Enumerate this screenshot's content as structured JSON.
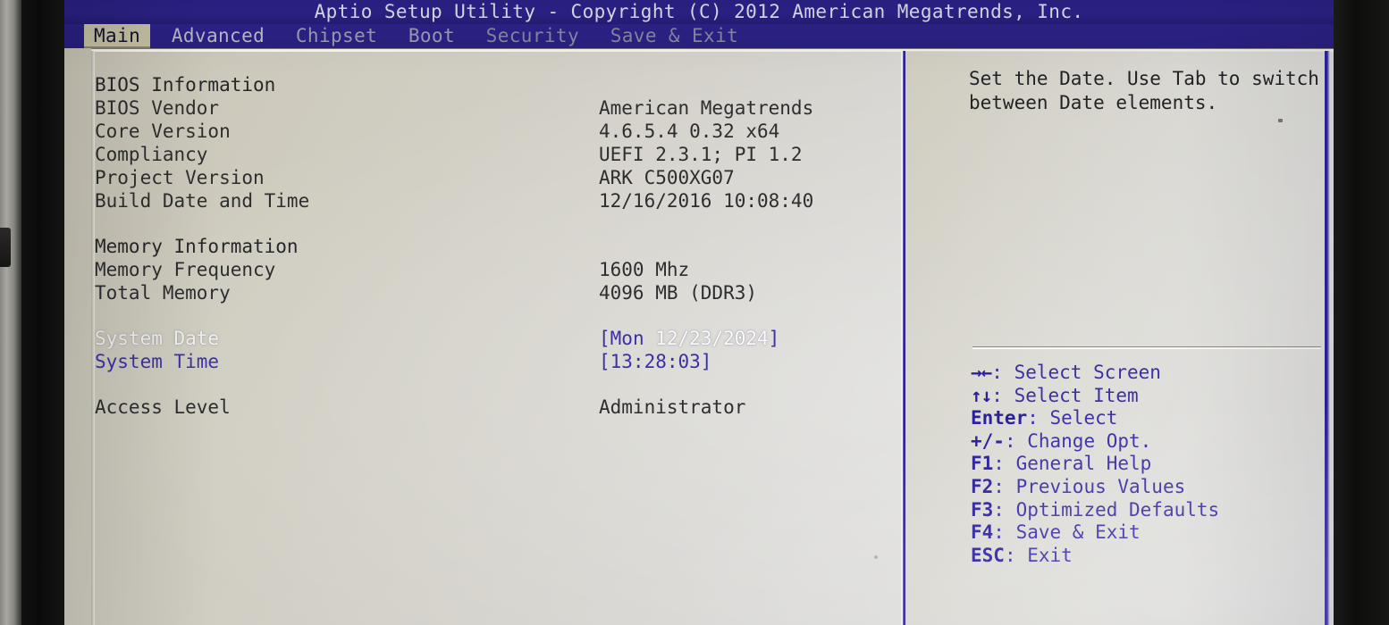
{
  "window": {
    "title": "Aptio Setup Utility - Copyright (C) 2012 American Megatrends, Inc."
  },
  "tabs": [
    {
      "label": "Main",
      "active": true
    },
    {
      "label": "Advanced",
      "active": false
    },
    {
      "label": "Chipset",
      "active": false
    },
    {
      "label": "Boot",
      "active": false
    },
    {
      "label": "Security",
      "active": false
    },
    {
      "label": "Save & Exit",
      "active": false
    }
  ],
  "main": {
    "sections": [
      {
        "heading": "BIOS Information",
        "rows": [
          {
            "label": "BIOS Vendor",
            "value": "American Megatrends"
          },
          {
            "label": "Core Version",
            "value": "4.6.5.4   0.32 x64"
          },
          {
            "label": "Compliancy",
            "value": "UEFI 2.3.1; PI 1.2"
          },
          {
            "label": "Project Version",
            "value": "ARK C500XG07"
          },
          {
            "label": "Build Date and Time",
            "value": "12/16/2016 10:08:40"
          }
        ]
      },
      {
        "heading": "Memory Information",
        "rows": [
          {
            "label": "Memory Frequency",
            "value": "1600 Mhz"
          },
          {
            "label": "Total Memory",
            "value": "4096 MB (DDR3)"
          }
        ]
      }
    ],
    "system_date": {
      "label": "System Date",
      "value_open_bracket": "[",
      "value_weekday": "Mon ",
      "value_date": "12/23/2024",
      "value_close_bracket": "]"
    },
    "system_time": {
      "label": "System Time",
      "value": "[13:28:03]"
    },
    "access_level": {
      "label": "Access Level",
      "value": "Administrator"
    }
  },
  "help": {
    "text": "Set the Date. Use Tab to switch between Date elements."
  },
  "keys": [
    {
      "key": "→←",
      "sep": ": ",
      "action": "Select Screen"
    },
    {
      "key": "↑↓",
      "sep": ": ",
      "action": "Select Item"
    },
    {
      "key": "Enter",
      "sep": ": ",
      "action": "Select"
    },
    {
      "key": "+/-",
      "sep": ": ",
      "action": "Change Opt."
    },
    {
      "key": "F1",
      "sep": ": ",
      "action": "General Help"
    },
    {
      "key": "F2",
      "sep": ": ",
      "action": "Previous Values"
    },
    {
      "key": "F3",
      "sep": ": ",
      "action": "Optimized Defaults"
    },
    {
      "key": "F4",
      "sep": ": ",
      "action": "Save & Exit"
    },
    {
      "key": "ESC",
      "sep": ": ",
      "action": "Exit"
    }
  ],
  "colors": {
    "titlebar_blue": "#2b2288",
    "tab_active_bg": "#c8c2a6",
    "accent_blue": "#3b2fa6",
    "screen_bg": "#d4d2cb",
    "text_dark": "#2c2c2e",
    "highlight_white": "#f6f5f1"
  }
}
